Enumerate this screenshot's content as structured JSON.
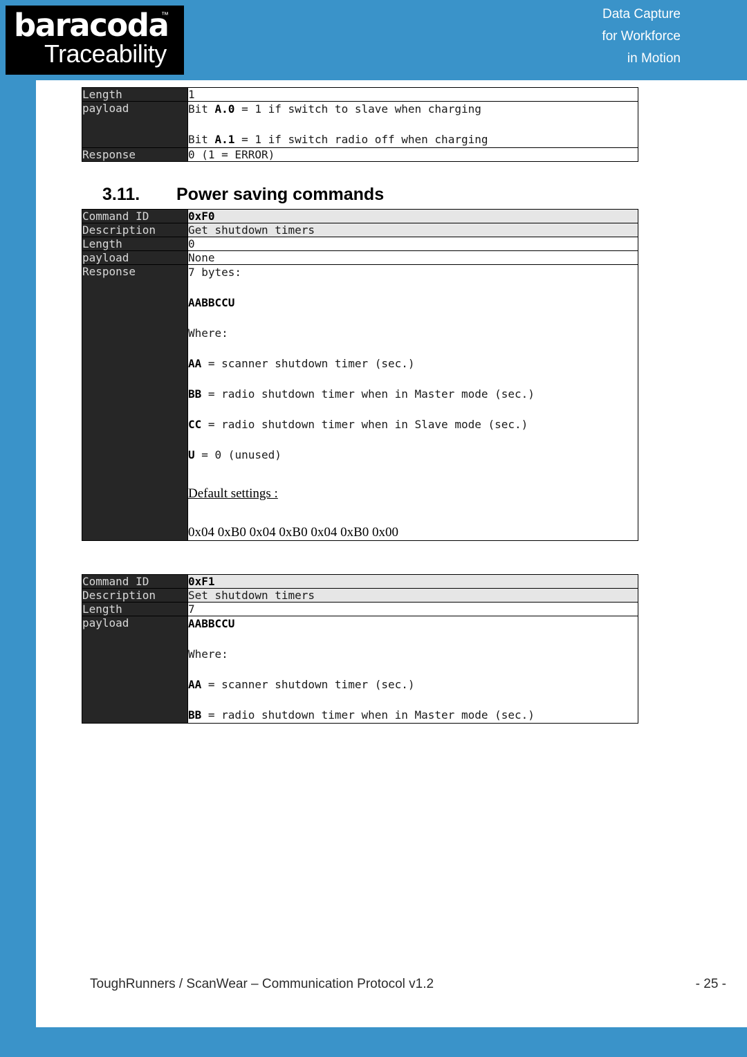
{
  "header": {
    "logo": {
      "main": "baracoda",
      "trademark": "™",
      "sub": "Traceability"
    },
    "tagline": {
      "line1": "Data Capture",
      "line2": "for Workforce",
      "line3": "in Motion"
    }
  },
  "colors": {
    "brand_blue": "#3a93c9",
    "label_cell": "#262626",
    "label_text": "#d9d9d9",
    "shaded_cell": "#e6e6e6"
  },
  "top_table": {
    "rows": [
      {
        "label": "Length",
        "value": "1"
      },
      {
        "label": "payload",
        "line1_prefix": "Bit ",
        "line1_bold": "A.0",
        "line1_suffix": " = 1 if switch to slave when charging",
        "line2_prefix": "Bit ",
        "line2_bold": "A.1",
        "line2_suffix": " = 1 if switch radio off when charging"
      },
      {
        "label": "Response",
        "value": "0 (1 = ERROR)"
      }
    ]
  },
  "section": {
    "number": "3.11.",
    "title": "Power saving commands"
  },
  "table_f0": {
    "rows": {
      "command_id": {
        "label": "Command ID",
        "value": "0xF0"
      },
      "description": {
        "label": "Description",
        "value": "Get shutdown timers"
      },
      "length": {
        "label": "Length",
        "value": "0"
      },
      "payload": {
        "label": "payload",
        "value": "None"
      },
      "response": {
        "label": "Response",
        "intro": "7 bytes:",
        "format": "AABBCCU",
        "where": "Where:",
        "defs": [
          {
            "key": "AA",
            "text": " = scanner shutdown timer (sec.)"
          },
          {
            "key": "BB",
            "text": " = radio shutdown timer when in Master mode (sec.)"
          },
          {
            "key": "CC",
            "text": " = radio shutdown timer when in Slave mode (sec.)"
          },
          {
            "key": "U",
            "text": " = 0 (unused)"
          }
        ],
        "defaults_label": "Default settings :",
        "defaults_value": "0x04 0xB0 0x04 0xB0 0x04 0xB0 0x00"
      }
    }
  },
  "table_f1": {
    "rows": {
      "command_id": {
        "label": "Command ID",
        "value": "0xF1"
      },
      "description": {
        "label": "Description",
        "value": "Set shutdown timers"
      },
      "length": {
        "label": "Length",
        "value": "7"
      },
      "payload": {
        "label": "payload",
        "format": "AABBCCU",
        "where": "Where:",
        "defs": [
          {
            "key": "AA",
            "text": " = scanner shutdown timer (sec.)"
          },
          {
            "key": "BB",
            "text": " = radio shutdown timer when in Master mode (sec.)"
          }
        ]
      }
    }
  },
  "footer": {
    "document": "ToughRunners / ScanWear – Communication Protocol v1.2",
    "page": "- 25 -"
  }
}
